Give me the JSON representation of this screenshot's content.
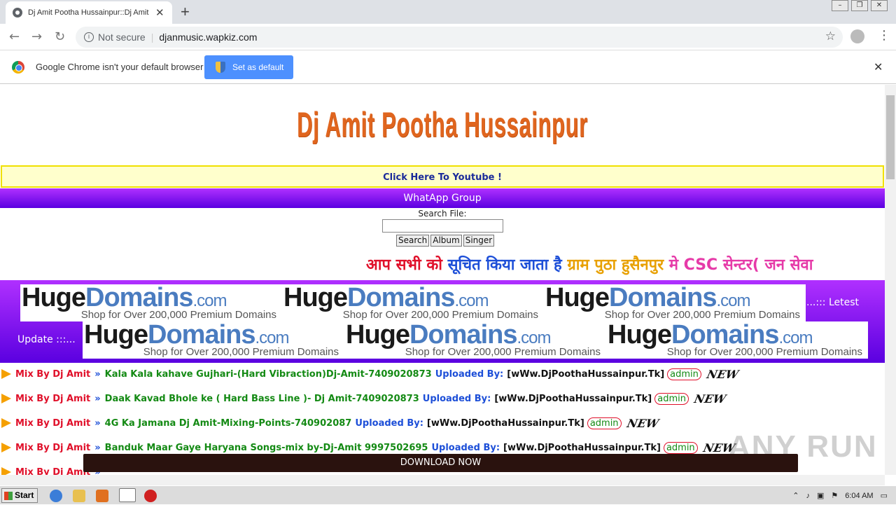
{
  "browser": {
    "tab_title": "Dj Amit Pootha Hussainpur::Dj Amit Pootha Hussainpur",
    "not_secure": "Not secure",
    "url": "djanmusic.wapkiz.com",
    "infobar_text": "Google Chrome isn't your default browser",
    "set_default_label": "Set as default"
  },
  "site": {
    "logo_text": "Dj Amit Pootha Hussainpur",
    "youtube_link": "Click Here To Youtube !",
    "whatsapp_link": "WhatApp Group",
    "search_label": "Search File:",
    "search_value": "",
    "buttons": {
      "search": "Search",
      "album": "Album",
      "singer": "Singer"
    },
    "marquee": {
      "part1": "आप सभी को",
      "part2": "सूचित किया जाता है",
      "part3": "ग्राम पुठा हुसैनपुर",
      "part4": "मे CSC सेन्टर( जन सेवा"
    },
    "ad": {
      "brand_huge": "Huge",
      "brand_domains": "Domains",
      "brand_tld": ".com",
      "tagline": "Shop for Over 200,000 Premium Domains"
    },
    "letest_right": "...::: Letest",
    "update_left": "Update :::...",
    "songs": [
      {
        "prefix": "Mix By Dj Amit",
        "sep": "»",
        "name": "Kala Kala kahave Gujhari-(Hard Vibraction)Dj-Amit-7409020873",
        "uploaded_label": "Uploaded By:",
        "site": "[wWw.DjPoothaHussainpur.Tk]",
        "uploader": "admin",
        "badge": "NEW"
      },
      {
        "prefix": "Mix By Dj Amit",
        "sep": "»",
        "name": "Daak Kavad Bhole ke ( Hard Bass Line )- Dj Amit-7409020873",
        "uploaded_label": "Uploaded By:",
        "site": "[wWw.DjPoothaHussainpur.Tk]",
        "uploader": "admin",
        "badge": "NEW"
      },
      {
        "prefix": "Mix By Dj Amit",
        "sep": "»",
        "name": "4G Ka Jamana Dj Amit-Mixing-Points-740902087",
        "uploaded_label": "Uploaded By:",
        "site": "[wWw.DjPoothaHussainpur.Tk]",
        "uploader": "admin",
        "badge": "NEW"
      },
      {
        "prefix": "Mix By Dj Amit",
        "sep": "»",
        "name": "Banduk Maar Gaye Haryana Songs-mix by-Dj-Amit 9997502695",
        "uploaded_label": "Uploaded By:",
        "site": "[wWw.DjPoothaHussainpur.Tk]",
        "uploader": "admin",
        "badge": "NEW"
      },
      {
        "prefix": "Mix By Dj Amit",
        "sep": "»",
        "name": "",
        "uploaded_label": "",
        "site": "",
        "uploader": "",
        "badge": ""
      }
    ],
    "download_bar": "DOWNLOAD NOW",
    "watermark": "ANY RUN"
  },
  "taskbar": {
    "start": "Start",
    "time": "6:04 AM"
  }
}
